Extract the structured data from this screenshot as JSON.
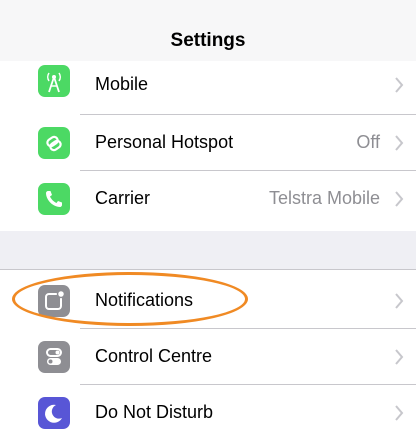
{
  "header": {
    "title": "Settings"
  },
  "rows_group1": [
    {
      "label": "Mobile",
      "value": "",
      "icon": "mobile-antenna-icon",
      "color": "#4cd964"
    },
    {
      "label": "Personal Hotspot",
      "value": "Off",
      "icon": "hotspot-link-icon",
      "color": "#4cd964"
    },
    {
      "label": "Carrier",
      "value": "Telstra Mobile",
      "icon": "phone-icon",
      "color": "#4cd964"
    }
  ],
  "rows_group2": [
    {
      "label": "Notifications",
      "value": "",
      "icon": "notifications-icon",
      "color": "#8e8e93"
    },
    {
      "label": "Control Centre",
      "value": "",
      "icon": "control-centre-icon",
      "color": "#8e8e93"
    },
    {
      "label": "Do Not Disturb",
      "value": "",
      "icon": "moon-icon",
      "color": "#5856d6"
    }
  ],
  "annotation": {
    "color": "#f08a24"
  }
}
